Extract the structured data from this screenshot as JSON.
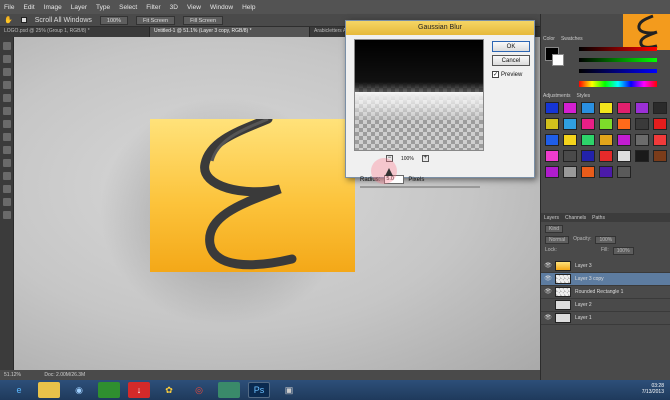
{
  "menu": [
    "File",
    "Edit",
    "Image",
    "Layer",
    "Type",
    "Select",
    "Filter",
    "3D",
    "View",
    "Window",
    "Help"
  ],
  "options": {
    "scroll_all": "Scroll All Windows",
    "buttons": [
      "100%",
      "Fit Screen",
      "Fill Screen"
    ]
  },
  "doc_tabs": [
    {
      "label": "LOGO.psd @ 25% (Group 1, RGB/8) *",
      "active": false
    },
    {
      "label": "Untitled-1 @ 51.1% (Layer 3 copy, RGB/8) *",
      "active": true
    },
    {
      "label": "Arabicletters Als...",
      "active": false
    }
  ],
  "status": {
    "zoom": "51.12%",
    "doc": "Doc: 2.00M/26.3M"
  },
  "dialog": {
    "title": "Gaussian Blur",
    "ok": "OK",
    "cancel": "Cancel",
    "preview_label": "Preview",
    "preview_checked": true,
    "zoom": "100%",
    "zoom_out": "−",
    "zoom_in": "+",
    "radius_label": "Radius:",
    "radius_value": "5.0",
    "unit": "Pixels"
  },
  "panels": {
    "color_tabs": [
      "Color",
      "Swatches"
    ],
    "styles_tabs": [
      "Adjustments",
      "Styles"
    ],
    "layers_tabs": [
      "Layers",
      "Channels",
      "Paths"
    ],
    "kind_label": "Kind",
    "blend_mode": "Normal",
    "opacity_label": "Opacity:",
    "opacity": "100%",
    "lock_label": "Lock:",
    "fill_label": "Fill:",
    "fill": "100%",
    "layers": [
      {
        "name": "Layer 3",
        "selected": false,
        "visible": true,
        "thumb": "orange"
      },
      {
        "name": "Layer 3 copy",
        "selected": true,
        "visible": true,
        "thumb": "checker"
      },
      {
        "name": "Rounded Rectangle 1",
        "selected": false,
        "visible": true,
        "thumb": "checker"
      },
      {
        "name": "Layer 2",
        "selected": false,
        "visible": false,
        "thumb": "plain"
      },
      {
        "name": "Layer 1",
        "selected": false,
        "visible": true,
        "thumb": "plain"
      }
    ]
  },
  "clock": {
    "time": "03:28",
    "date": "7/13/2013"
  },
  "colors": {
    "accent": "#f4a818",
    "selection": "#5d7ca0"
  }
}
